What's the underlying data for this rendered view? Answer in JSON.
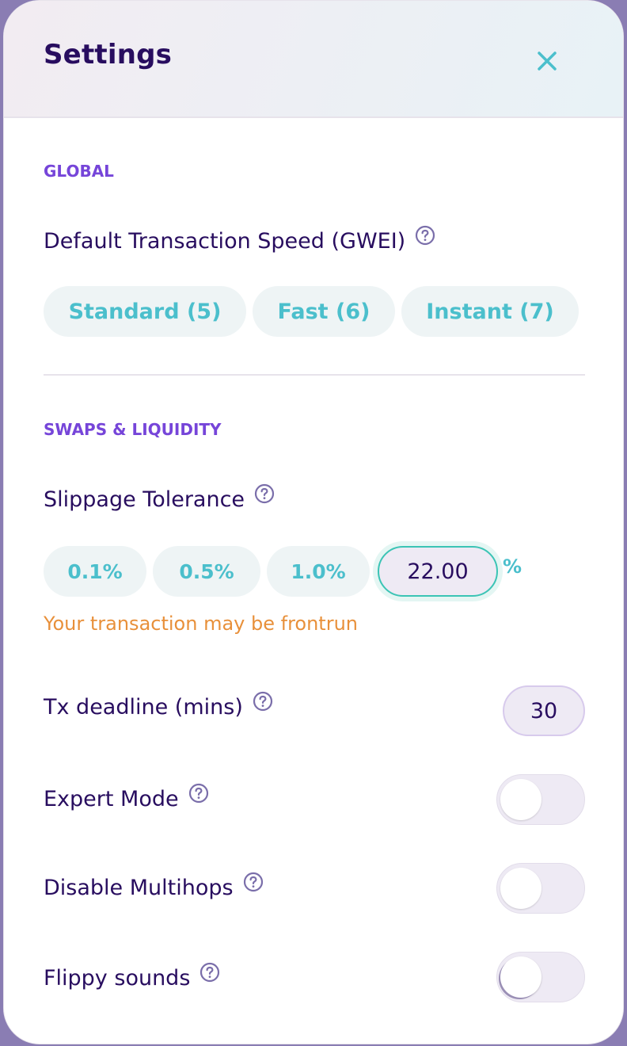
{
  "modal": {
    "title": "Settings"
  },
  "global": {
    "section_label": "GLOBAL",
    "tx_speed_label": "Default Transaction Speed (GWEI)",
    "speed_options": [
      "Standard (5)",
      "Fast (6)",
      "Instant (7)"
    ]
  },
  "swaps": {
    "section_label": "SWAPS & LIQUIDITY",
    "slippage_label": "Slippage Tolerance",
    "slippage_options": [
      "0.1%",
      "0.5%",
      "1.0%"
    ],
    "slippage_value": "22.00",
    "slippage_unit": "%",
    "slippage_warning": "Your transaction may be frontrun",
    "deadline_label": "Tx deadline (mins)",
    "deadline_value": "30",
    "toggles": [
      {
        "label": "Expert Mode",
        "on": false
      },
      {
        "label": "Disable Multihops",
        "on": false
      },
      {
        "label": "Flippy sounds",
        "on": false
      }
    ]
  },
  "icons": {
    "close": "close-icon",
    "help": "help-icon"
  },
  "colors": {
    "title": "#280d5f",
    "section": "#7645d9",
    "accent": "#4bbfcc",
    "warning": "#e8903a",
    "input_border": "#3bc4b5"
  }
}
